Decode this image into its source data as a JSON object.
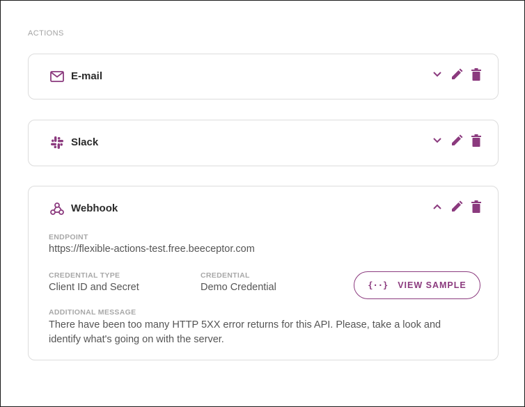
{
  "section": {
    "title": "ACTIONS"
  },
  "colors": {
    "accent": "#8b3a7e",
    "border": "#dcdcdc",
    "label": "#a8a8a8",
    "text": "#555555"
  },
  "actions": [
    {
      "name": "E-mail",
      "icon": "mail-icon",
      "expanded": false
    },
    {
      "name": "Slack",
      "icon": "slack-icon",
      "expanded": false
    },
    {
      "name": "Webhook",
      "icon": "webhook-icon",
      "expanded": true,
      "endpoint_label": "ENDPOINT",
      "endpoint": "https://flexible-actions-test.free.beeceptor.com",
      "credential_type_label": "CREDENTIAL TYPE",
      "credential_type": "Client ID and Secret",
      "credential_label": "CREDENTIAL",
      "credential": "Demo Credential",
      "view_sample_label": "VIEW SAMPLE",
      "view_sample_icon": "{··}",
      "message_label": "ADDITIONAL MESSAGE",
      "message": "There have been too many HTTP 5XX error returns for this API. Please, take a look and identify what's going on with the server."
    }
  ]
}
